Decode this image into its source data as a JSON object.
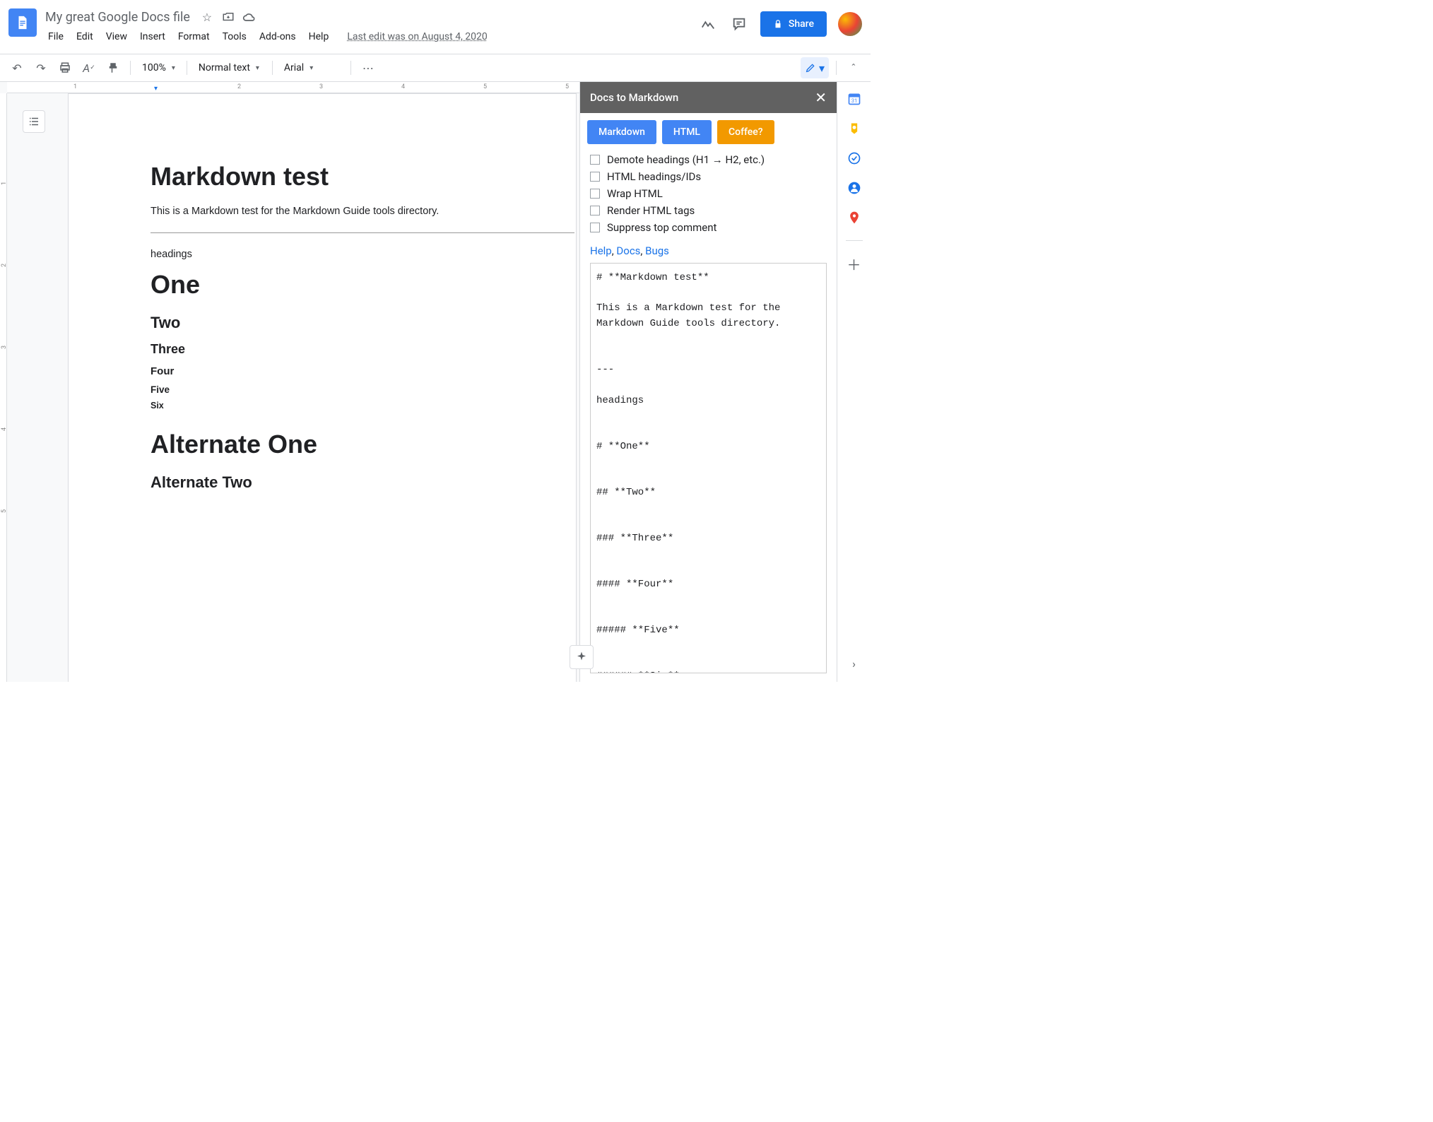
{
  "header": {
    "doc_title": "My great Google Docs file",
    "last_edit": "Last edit was on August 4, 2020",
    "share_label": "Share",
    "menu": [
      "File",
      "Edit",
      "View",
      "Insert",
      "Format",
      "Tools",
      "Add-ons",
      "Help"
    ]
  },
  "toolbar": {
    "zoom": "100%",
    "style": "Normal text",
    "font": "Arial"
  },
  "ruler": {
    "nums": [
      "1",
      "2",
      "3",
      "4",
      "5"
    ]
  },
  "ruler_v": {
    "nums": [
      "1",
      "2",
      "3",
      "4",
      "5"
    ]
  },
  "document": {
    "title": "Markdown test",
    "intro": "This is a Markdown test for the Markdown Guide tools directory.",
    "headings_label": "headings",
    "h1": "One",
    "h2": "Two",
    "h3": "Three",
    "h4": "Four",
    "h5": "Five",
    "h6": "Six",
    "alt1": "Alternate One",
    "alt2": "Alternate Two"
  },
  "addon": {
    "title": "Docs to Markdown",
    "tabs": {
      "markdown": "Markdown",
      "html": "HTML",
      "coffee": "Coffee?"
    },
    "checks": [
      "Demote headings (H1 → H2, etc.)",
      "HTML headings/IDs",
      "Wrap HTML",
      "Render HTML tags",
      "Suppress top comment"
    ],
    "links": {
      "help": "Help",
      "docs": "Docs",
      "bugs": "Bugs"
    },
    "output": "# **Markdown test**\n\nThis is a Markdown test for the Markdown Guide tools directory.\n\n\n---\n\nheadings\n\n\n# **One**\n\n\n## **Two**\n\n\n### **Three**\n\n\n#### **Four**\n\n\n##### **Five**\n\n\n###### **Six**\n\n\n# **Alternate One**\n\n\n## **Alternate Two**"
  }
}
